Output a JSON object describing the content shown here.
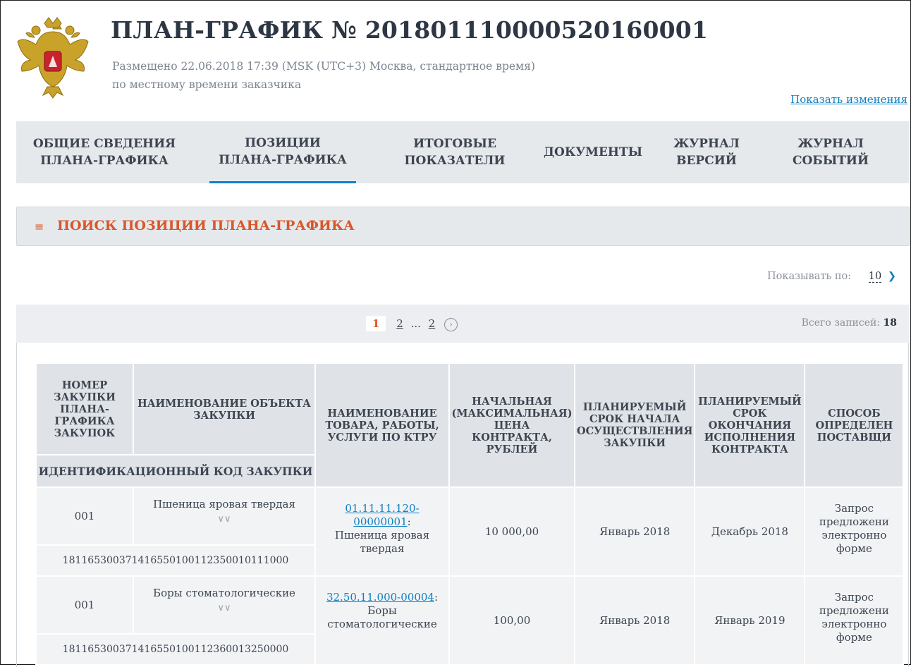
{
  "header": {
    "title": "ПЛАН-ГРАФИК № 201801110000520160001",
    "posted": "Размещено 22.06.2018 17:39 (MSK (UTC+3) Москва, стандартное время)",
    "posted_note": "по местному времени заказчика",
    "show_changes": "Показать изменения"
  },
  "tabs": [
    {
      "line1": "ОБЩИЕ СВЕДЕНИЯ",
      "line2": "ПЛАНА-ГРАФИКА"
    },
    {
      "line1": "ПОЗИЦИИ",
      "line2": "ПЛАНА-ГРАФИКА"
    },
    {
      "line1": "ИТОГОВЫЕ",
      "line2": "ПОКАЗАТЕЛИ"
    },
    {
      "line1": "ДОКУМЕНТЫ",
      "line2": ""
    },
    {
      "line1": "ЖУРНАЛ",
      "line2": "ВЕРСИЙ"
    },
    {
      "line1": "ЖУРНАЛ",
      "line2": "СОБЫТИЙ"
    }
  ],
  "active_tab_index": 1,
  "search": {
    "label": "ПОИСК ПОЗИЦИИ ПЛАНА-ГРАФИКА"
  },
  "per_page": {
    "label": "Показывать по:",
    "value": "10"
  },
  "pagination": {
    "current": "1",
    "page2": "2",
    "dots": "...",
    "last": "2",
    "next": "›"
  },
  "total": {
    "label": "Всего записей:",
    "value": "18"
  },
  "table": {
    "h_number": [
      "НОМЕР",
      "ЗАКУПКИ",
      "ПЛАНА-",
      "ГРАФИКА",
      "ЗАКУПОК"
    ],
    "h_object": [
      "НАИМЕНОВАНИЕ ОБЪЕКТА",
      "ЗАКУПКИ"
    ],
    "h_code": "ИДЕНТИФИКАЦИОННЫЙ КОД ЗАКУПКИ",
    "h_ktru": [
      "НАИМЕНОВАНИЕ",
      "ТОВАРА, РАБОТЫ,",
      "УСЛУГИ ПО КТРУ"
    ],
    "h_price": [
      "НАЧАЛЬНАЯ",
      "(МАКСИМАЛЬНАЯ)",
      "ЦЕНА",
      "КОНТРАКТА,",
      "РУБЛЕЙ"
    ],
    "h_start": [
      "ПЛАНИРУЕМЫЙ",
      "СРОК НАЧАЛА",
      "ОСУЩЕСТВЛЕНИЯ",
      "ЗАКУПКИ"
    ],
    "h_end": [
      "ПЛАНИРУЕМЫЙ",
      "СРОК",
      "ОКОНЧАНИЯ",
      "ИСПОЛНЕНИЯ",
      "КОНТРАКТА"
    ],
    "h_method": [
      "СПОСОБ",
      "ОПРЕДЕЛЕН",
      "ПОСТАВЩИ"
    ],
    "rows": [
      {
        "number": "001",
        "object": "Пшеница яровая твердая",
        "code": "181165300371416550100112350010111000",
        "ktru_code": "01.11.11.120-00000001",
        "ktru_name": [
          "Пшеница яровая",
          "твердая"
        ],
        "price": "10 000,00",
        "start": "Январь 2018",
        "end": "Декабрь 2018",
        "method": [
          "Запрос",
          "предложени",
          "электронно",
          "форме"
        ]
      },
      {
        "number": "001",
        "object": "Боры стоматологические",
        "code": "181165300371416550100112360013250000",
        "ktru_code": "32.50.11.000-00004",
        "ktru_name": [
          "Боры",
          "стоматологические"
        ],
        "price": "100,00",
        "start": "Январь 2018",
        "end": "Январь 2019",
        "method": [
          "Запрос",
          "предложени",
          "электронно",
          "форме"
        ]
      }
    ]
  },
  "colors": {
    "accent": "#d8572a",
    "link": "#0f7fc0",
    "tab_bg": "#e6e9ec",
    "header_cell": "#dfe3e7",
    "body_cell": "#f1f3f5"
  }
}
